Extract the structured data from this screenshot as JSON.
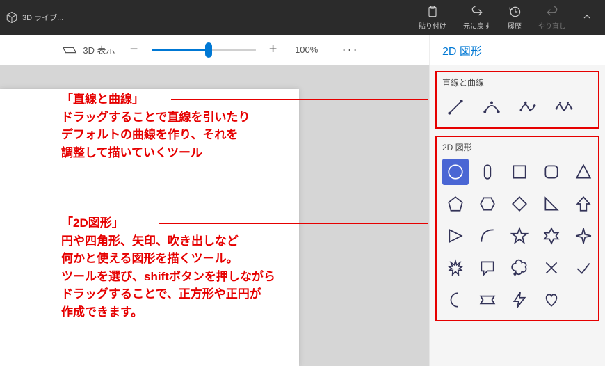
{
  "titlebar": {
    "app_label": "3D ライブ...",
    "actions": {
      "paste": "貼り付け",
      "undo": "元に戻す",
      "history": "履歴",
      "redo": "やり直し"
    }
  },
  "toolbar": {
    "view3d_label": "3D 表示",
    "zoom_value": "100%",
    "panel_title": "2D 図形"
  },
  "panel": {
    "lines_group_title": "直線と曲線",
    "shapes_group_title": "2D 図形",
    "line_tools": [
      "line",
      "curve-3pt",
      "curve-4pt",
      "curve-5pt"
    ],
    "shapes": [
      "circle",
      "oval",
      "square",
      "rounded-square",
      "triangle-up",
      "pentagon",
      "hexagon",
      "diamond",
      "right-triangle",
      "arrow-up",
      "triangle-mark",
      "quarter-arc",
      "star-5",
      "star-6",
      "star-4",
      "burst",
      "speech-bubble",
      "thought-bubble",
      "cross",
      "check",
      "moon",
      "banner",
      "lightning",
      "heart"
    ],
    "selected_shape": "circle"
  },
  "annotations": {
    "a1": {
      "heading": "「直線と曲線」",
      "body": "ドラッグすることで直線を引いたり\nデフォルトの曲線を作り、それを\n調整して描いていくツール"
    },
    "a2": {
      "heading": "「2D図形」",
      "body": "円や四角形、矢印、吹き出しなど\n何かと使える図形を描くツール。\nツールを選び、shiftボタンを押しながら\nドラッグすることで、正方形や正円が\n作成できます。"
    }
  }
}
